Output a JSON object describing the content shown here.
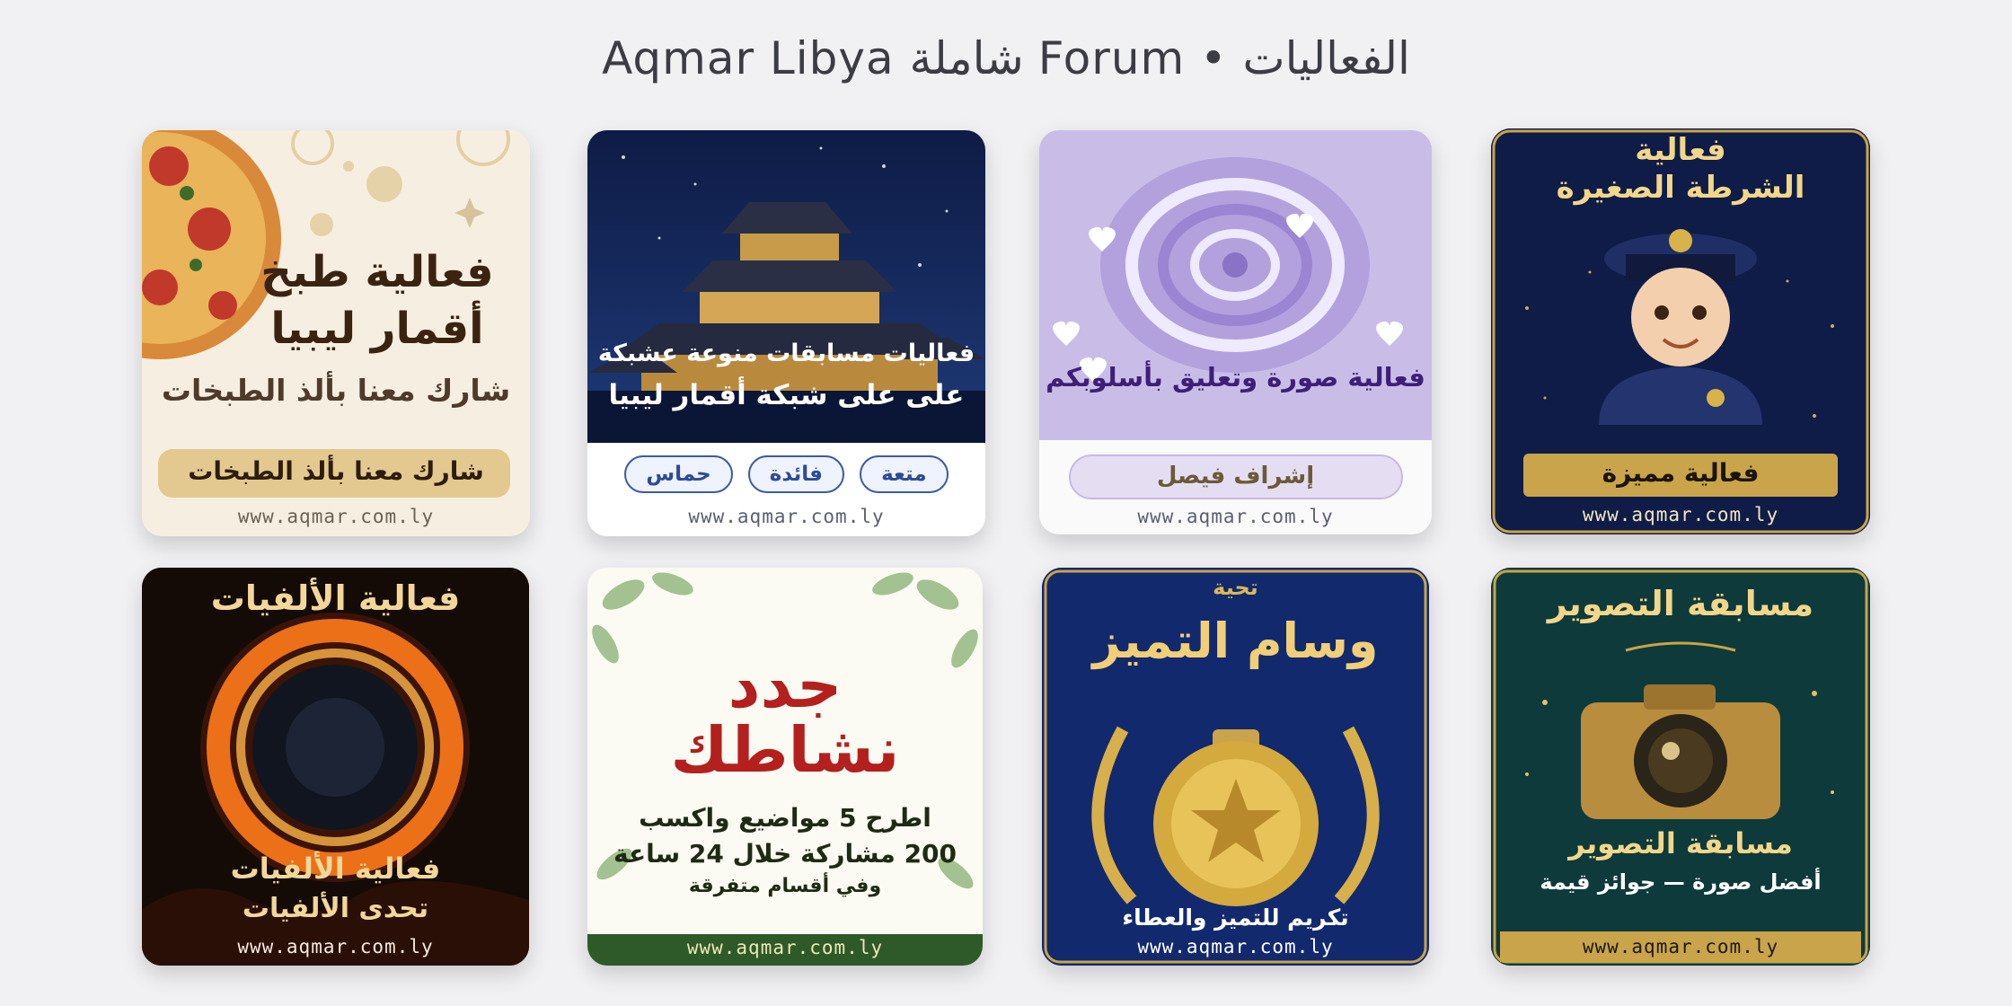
{
  "page": {
    "title": "Aqmar Libya شاملة Forum • الفعاليات"
  },
  "cards": [
    {
      "title1": "فعالية طبخ",
      "title2": "أقمار ليبيا",
      "subtitle": "شارك معنا بألذ الطبخات",
      "button": "شارك معنا بألذ الطبخات",
      "url": "www.aqmar.com.ly"
    },
    {
      "line1": "فعاليات مسابقات منوعة عشبكة",
      "line2": "على على شبكة أقمار ليبيا",
      "tags": [
        "متعة",
        "فائدة",
        "حماس"
      ],
      "url": "www.aqmar.com.ly"
    },
    {
      "caption": "فعالية صورة وتعليق بأسلوبكم",
      "button": "إشراف فيصل",
      "url": "www.aqmar.com.ly"
    },
    {
      "title1": "فعالية",
      "title2": "الشرطة الصغيرة",
      "banner": "فعالية مميزة",
      "url": "www.aqmar.com.ly"
    },
    {
      "title": "فعالية الألفيات",
      "line1": "فعالية الألفيات",
      "line2": "تحدى الألفيات",
      "url": "www.aqmar.com.ly"
    },
    {
      "title1": "جدد",
      "title2": "نشاطك",
      "line1": "اطرح 5 مواضيع واكسب",
      "line2": "200 مشاركة خلال 24 ساعة",
      "line3": "وفي أقسام متفرقة",
      "url": "www.aqmar.com.ly"
    },
    {
      "kicker": "تحية",
      "title": "وسام التميز",
      "caption": "تكريم للتميز والعطاء",
      "url": "www.aqmar.com.ly"
    },
    {
      "title": "مسابقة التصوير",
      "line1": "مسابقة التصوير",
      "line2": "أفضل صورة — جوائز قيمة",
      "url": "www.aqmar.com.ly"
    }
  ],
  "colors": {
    "accent_gold": "#c9a44a",
    "navy": "#13265e",
    "cream": "#f6efe1"
  }
}
